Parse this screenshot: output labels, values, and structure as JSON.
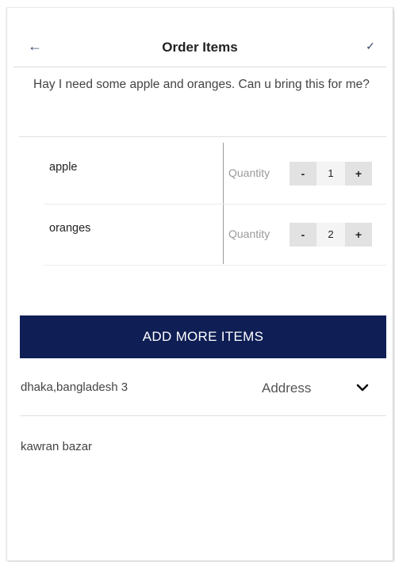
{
  "header": {
    "title": "Order Items",
    "back_icon": "arrow-left-icon",
    "confirm_icon": "check-icon"
  },
  "message": {
    "text": "Hay I need some apple and oranges. Can u bring this for me?"
  },
  "items": [
    {
      "name": "apple",
      "quantity_label": "Quantity",
      "minus": "-",
      "quantity": "1",
      "plus": "+"
    },
    {
      "name": "oranges",
      "quantity_label": "Quantity",
      "minus": "-",
      "quantity": "2",
      "plus": "+"
    }
  ],
  "add_button": {
    "label": "ADD MORE ITEMS",
    "color": "#0f1f55"
  },
  "address": {
    "city": "dhaka,bangladesh 3",
    "label": "Address",
    "dropdown_icon": "chevron-down-icon",
    "street": "kawran bazar"
  }
}
